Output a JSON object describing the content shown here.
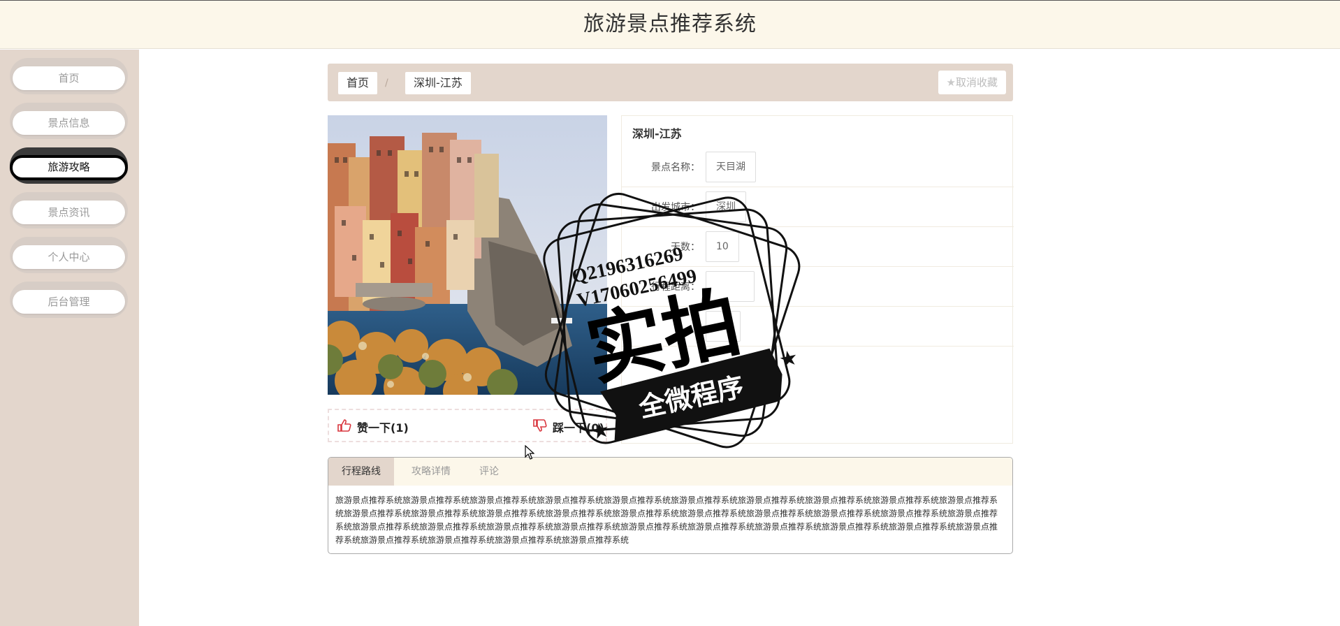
{
  "header": {
    "title": "旅游景点推荐系统"
  },
  "sidebar": {
    "items": [
      {
        "label": "首页"
      },
      {
        "label": "景点信息"
      },
      {
        "label": "旅游攻略"
      },
      {
        "label": "景点资讯"
      },
      {
        "label": "个人中心"
      },
      {
        "label": "后台管理"
      }
    ],
    "active_index": 2
  },
  "breadcrumb": {
    "home": "首页",
    "separator": "/",
    "current": "深圳-江苏"
  },
  "favorite_button": {
    "icon": "star-icon",
    "label": "取消收藏"
  },
  "detail": {
    "title": "深圳-江苏",
    "fields": [
      {
        "label": "景点名称：",
        "value": "天目湖"
      },
      {
        "label": "出发城市：",
        "value": "深圳"
      },
      {
        "label": "天数：",
        "value": "10"
      },
      {
        "label": "行程距离：",
        "value": ""
      },
      {
        "label": "",
        "value": ""
      }
    ]
  },
  "votes": {
    "like_label": "赞一下(1)",
    "dislike_label": "踩一下(0)"
  },
  "tabs": {
    "items": [
      {
        "label": "行程路线"
      },
      {
        "label": "攻略详情"
      },
      {
        "label": "评论"
      }
    ],
    "active_index": 0,
    "content": "旅游景点推荐系统旅游景点推荐系统旅游景点推荐系统旅游景点推荐系统旅游景点推荐系统旅游景点推荐系统旅游景点推荐系统旅游景点推荐系统旅游景点推荐系统旅游景点推荐系统旅游景点推荐系统旅游景点推荐系统旅游景点推荐系统旅游景点推荐系统旅游景点推荐系统旅游景点推荐系统旅游景点推荐系统旅游景点推荐系统旅游景点推荐系统旅游景点推荐系统旅游景点推荐系统旅游景点推荐系统旅游景点推荐系统旅游景点推荐系统旅游景点推荐系统旅游景点推荐系统旅游景点推荐系统旅游景点推荐系统旅游景点推荐系统旅游景点推荐系统旅游景点推荐系统旅游景点推荐系统旅游景点推荐系统旅游景点推荐系统"
  },
  "watermark": {
    "line1": "Q2196316269",
    "line2": "V17060256499",
    "main": "实拍",
    "banner": "全微程序"
  },
  "colors": {
    "header_bg": "#fcf7ea",
    "sidebar_bg": "#e3d6cc",
    "accent": "#e3d6cc",
    "like_icon": "#d9363e"
  }
}
